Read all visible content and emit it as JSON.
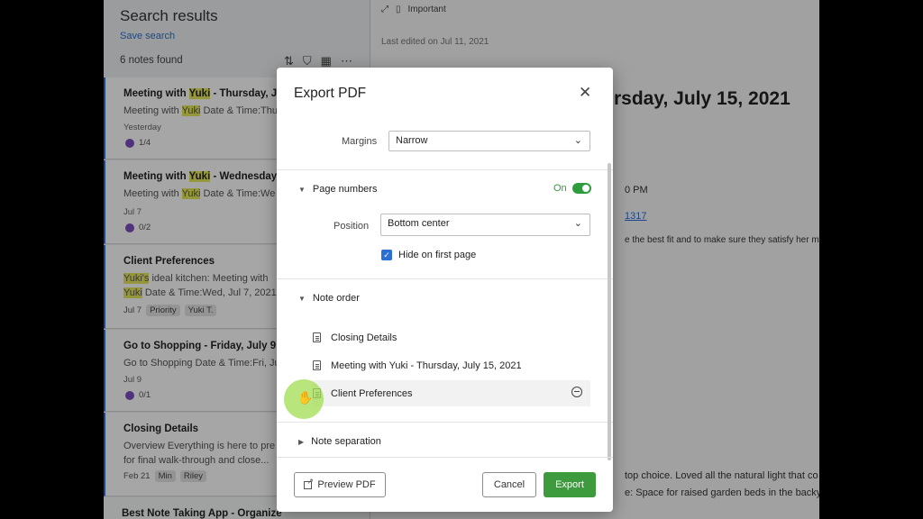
{
  "left_pane": {
    "title": "Search results",
    "save_search": "Save search",
    "count": "6 notes found",
    "tools": [
      "sort-icon",
      "filter-icon",
      "view-icon",
      "more-icon"
    ]
  },
  "cards": [
    {
      "title_a": "Meeting with ",
      "title_hl": "Yuki",
      "title_b": " - Thursday, July",
      "snip_a": "Meeting with ",
      "snip_hl": "Yuki",
      "snip_b": " Date & Time:Thu",
      "date": "Yesterday",
      "badge": "1/4"
    },
    {
      "title_a": "Meeting with ",
      "title_hl": "Yuki",
      "title_b": " - Wednesday, J",
      "snip_a": "Meeting with ",
      "snip_hl": "Yuki",
      "snip_b": " Date & Time:We",
      "date": "Jul 7",
      "badge": "0/2"
    },
    {
      "title": "Client Preferences",
      "snip1_hl": "Yuki's",
      "snip1_b": " ideal kitchen: Meeting with",
      "snip2_hl": "Yuki",
      "snip2_b": " Date & Time:Wed, Jul 7, 2021,",
      "date": "Jul 7",
      "tags": [
        "Priority",
        "Yuki T."
      ]
    },
    {
      "title": "Go to Shopping - Friday, July 9, 2",
      "snip": "Go to Shopping Date & Time:Fri, Ju",
      "date": "Jul 9",
      "badge": "0/1"
    },
    {
      "title": "Closing Details",
      "snip1": "Overview Everything is here to pre",
      "snip2": "for final walk-through and close...",
      "date": "Feb 21",
      "tags": [
        "Min",
        "Riley"
      ]
    },
    {
      "title": "Best Note Taking App - Organize"
    }
  ],
  "note": {
    "important": "Important",
    "edited": "Last edited on Jul 11, 2021",
    "title_fragment": "rsday, July 15, 2021",
    "t1": "0 PM",
    "t2": "1317",
    "t3": "e the best fit and to make sure they satisfy her mus",
    "t4": "top choice. Loved all the natural light that co",
    "t5": "e: Space for raised garden beds in the backya"
  },
  "modal": {
    "title": "Export PDF",
    "margins_label": "Margins",
    "margins_value": "Narrow",
    "page_numbers_label": "Page numbers",
    "page_numbers_state": "On",
    "position_label": "Position",
    "position_value": "Bottom center",
    "hide_first_label": "Hide on first page",
    "note_order_label": "Note order",
    "notes": [
      "Closing Details",
      "Meeting with Yuki - Thursday, July 15, 2021",
      "Client Preferences"
    ],
    "note_separation_label": "Note separation",
    "preview_label": "Preview PDF",
    "cancel_label": "Cancel",
    "export_label": "Export"
  },
  "colors": {
    "accent_green": "#3d9b3d",
    "accent_blue": "#2a6fd6",
    "highlight": "#e6e85a"
  }
}
